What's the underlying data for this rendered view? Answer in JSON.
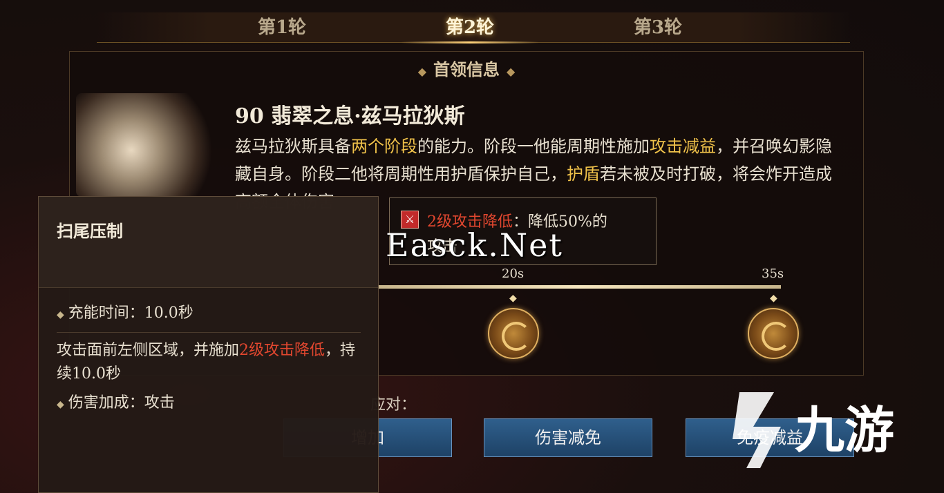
{
  "tabs": [
    {
      "label": "第1轮",
      "active": false
    },
    {
      "label": "第2轮",
      "active": true
    },
    {
      "label": "第3轮",
      "active": false
    }
  ],
  "panel": {
    "title": "首领信息",
    "boss_name": "90 翡翠之息·兹马拉狄斯",
    "desc": {
      "p1": "兹马拉狄斯具备",
      "h1": "两个阶段",
      "p2": "的能力。阶段一他能周期性施加",
      "h2": "攻击减益",
      "p3": "，并召唤幻影隐藏自身。阶段二他将周期性用护盾保护自己，",
      "h3": "护盾",
      "p4": "若未被及时打破，将会炸开造成高额全体伤害"
    }
  },
  "timeline": {
    "marks": [
      {
        "label": "20s",
        "icon": "dragon-swirl-icon"
      },
      {
        "label": "35s",
        "icon": "dragon-claw-icon"
      }
    ]
  },
  "counter": {
    "label": "应对：",
    "buttons": [
      "增加",
      "伤害减免",
      "免疫减益"
    ]
  },
  "debuff_tooltip": {
    "name": "2级攻击降低",
    "sep": "：",
    "effect": "降低50%的",
    "line2": "攻击"
  },
  "skill": {
    "title": "扫尾压制",
    "charge": "充能时间：10.0秒",
    "desc_a": "攻击面前左侧区域，并施加",
    "desc_red": "2级攻击降低",
    "desc_b": "，持续10.0秒",
    "bonus": "伤害加成：攻击"
  },
  "watermark": "Easck.Net",
  "logo": {
    "text": "九游",
    "color": "#ffffff"
  }
}
